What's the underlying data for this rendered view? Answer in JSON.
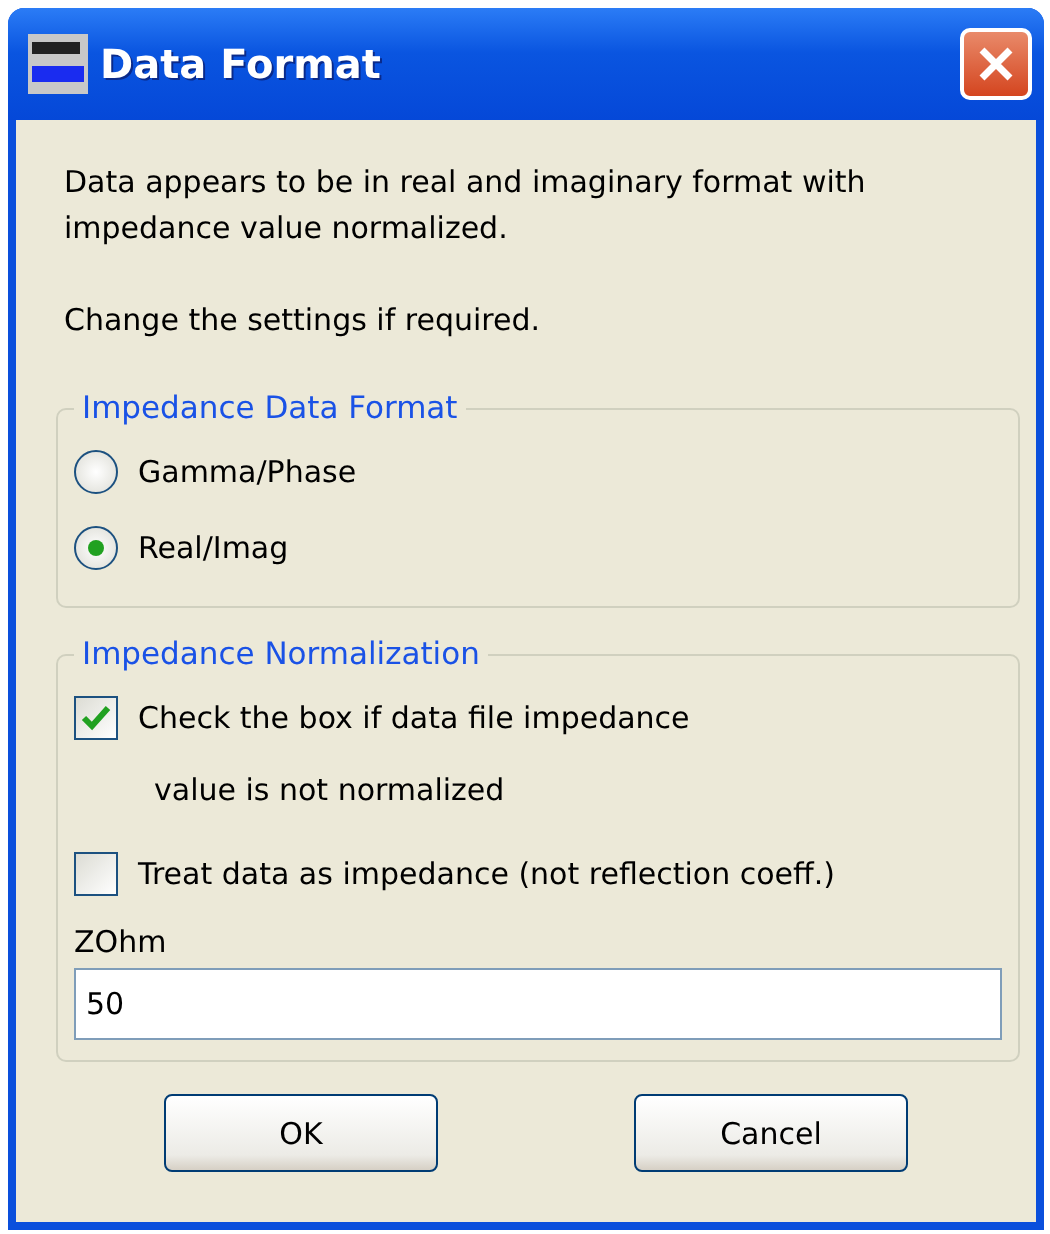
{
  "window": {
    "title": "Data Format"
  },
  "message": [
    "Data appears to be in real and imaginary format with impedance value normalized.",
    "Change the settings if required."
  ],
  "format_group": {
    "title": "Impedance Data Format",
    "options": [
      {
        "label": "Gamma/Phase",
        "selected": false
      },
      {
        "label": "Real/Imag",
        "selected": true
      }
    ]
  },
  "normalization_group": {
    "title": "Impedance Normalization",
    "checkboxes": [
      {
        "label": "Check the box if data file impedance",
        "note": "value is not normalized",
        "checked": true
      },
      {
        "label": "Treat data as impedance (not reflection coeff.)",
        "checked": false
      }
    ],
    "field": {
      "label": "ZOhm",
      "value": "50"
    }
  },
  "buttons": [
    "OK",
    "Cancel"
  ]
}
